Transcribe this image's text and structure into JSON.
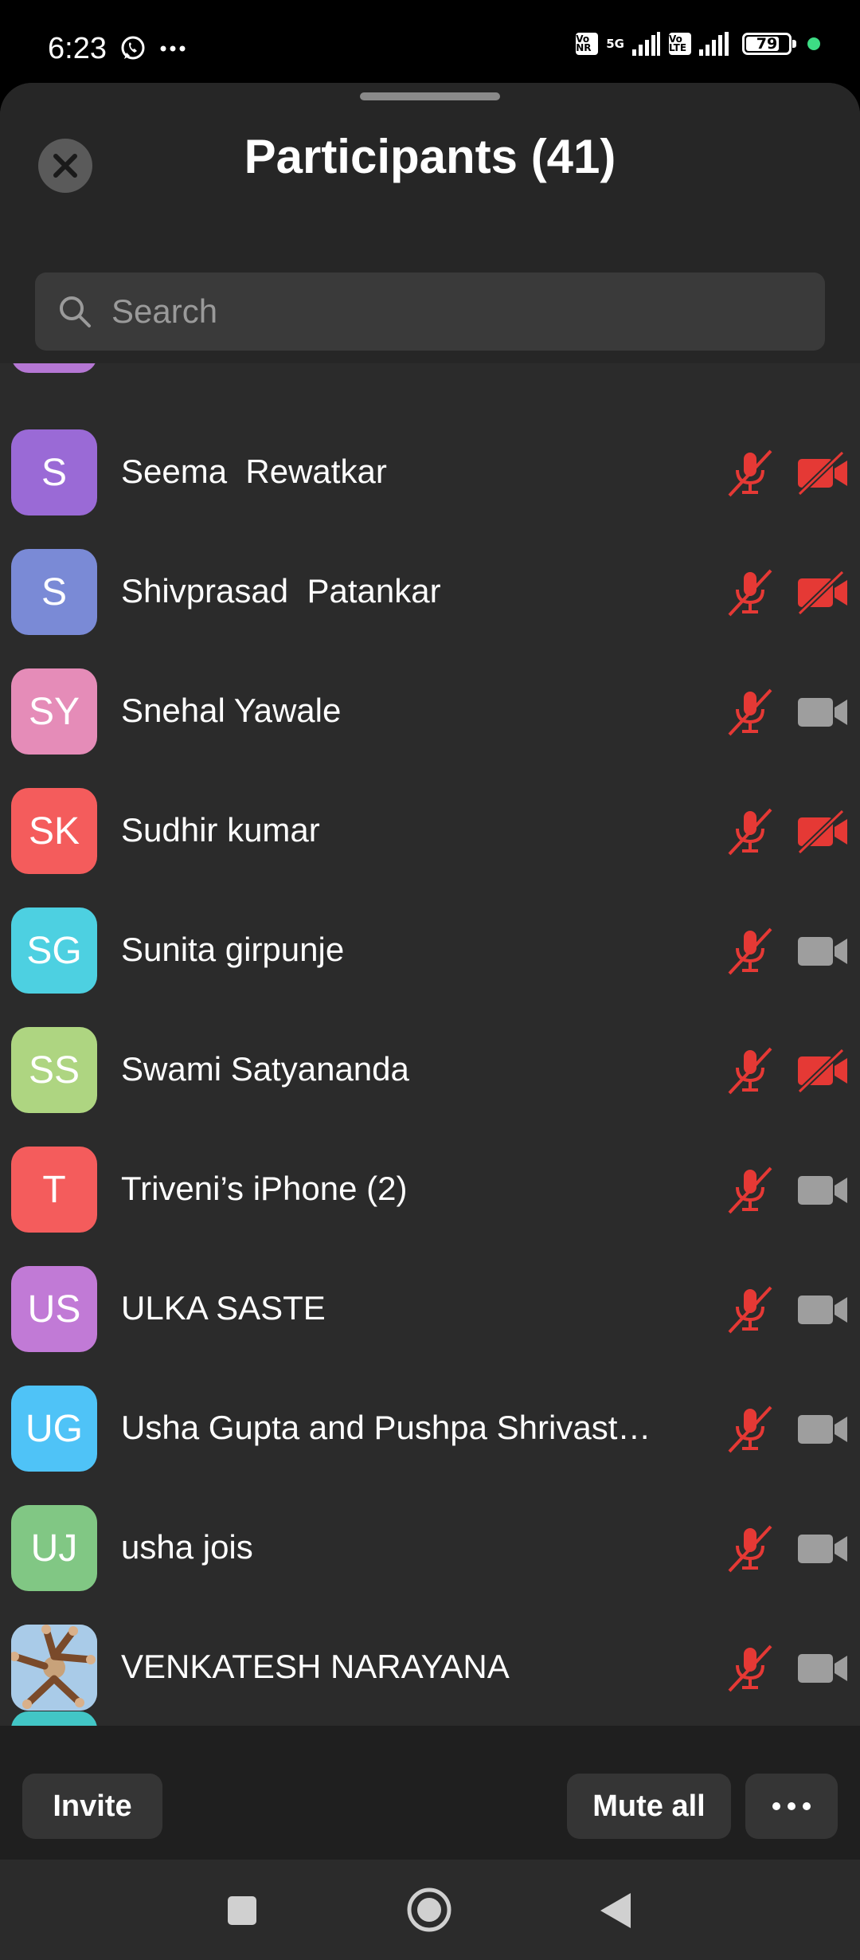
{
  "status_bar": {
    "time": "6:23",
    "network_badge_1": "Vo NR",
    "network_type": "5G",
    "network_badge_2": "Vo LTE",
    "battery": "79",
    "icons": [
      "whatsapp-icon",
      "more-dots-icon",
      "signal-icon",
      "battery-icon"
    ]
  },
  "header": {
    "title": "Participants (41)",
    "close_icon": "close-icon"
  },
  "search": {
    "placeholder": "Search"
  },
  "participants": [
    {
      "initials": "S",
      "name": "Seema  Rewatkar",
      "color": "#9a6ad6",
      "mic_muted": true,
      "video_off": true
    },
    {
      "initials": "S",
      "name": "Shivprasad  Patankar",
      "color": "#7a8ad6",
      "mic_muted": true,
      "video_off": true
    },
    {
      "initials": "SY",
      "name": "Snehal Yawale",
      "color": "#e58cb8",
      "mic_muted": true,
      "video_off": false
    },
    {
      "initials": "SK",
      "name": "Sudhir kumar",
      "color": "#f45c5c",
      "mic_muted": true,
      "video_off": true
    },
    {
      "initials": "SG",
      "name": "Sunita girpunje",
      "color": "#4dd0e1",
      "mic_muted": true,
      "video_off": false
    },
    {
      "initials": "SS",
      "name": "Swami Satyananda",
      "color": "#aed581",
      "mic_muted": true,
      "video_off": true
    },
    {
      "initials": "T",
      "name": "Triveni’s iPhone (2)",
      "color": "#f45c5c",
      "mic_muted": true,
      "video_off": false
    },
    {
      "initials": "US",
      "name": "ULKA SASTE",
      "color": "#c17ad6",
      "mic_muted": true,
      "video_off": false
    },
    {
      "initials": "UG",
      "name": "Usha Gupta and Pushpa Shrivast…",
      "color": "#4fc3f7",
      "mic_muted": true,
      "video_off": false
    },
    {
      "initials": "UJ",
      "name": "usha jois",
      "color": "#81c784",
      "mic_muted": true,
      "video_off": false
    },
    {
      "initials": "",
      "name": "VENKATESH NARAYANA",
      "color": "#9ec5e8",
      "photo": true,
      "mic_muted": true,
      "video_off": false
    }
  ],
  "footer": {
    "invite_label": "Invite",
    "mute_all_label": "Mute all",
    "more_icon": "more-horizontal-icon"
  },
  "nav": {
    "icons": [
      "recents-square-icon",
      "home-circle-icon",
      "back-triangle-icon"
    ]
  },
  "colors": {
    "sheet_bg": "#2b2b2b",
    "muted_red": "#e53935",
    "video_on_grey": "#9e9e9e"
  }
}
